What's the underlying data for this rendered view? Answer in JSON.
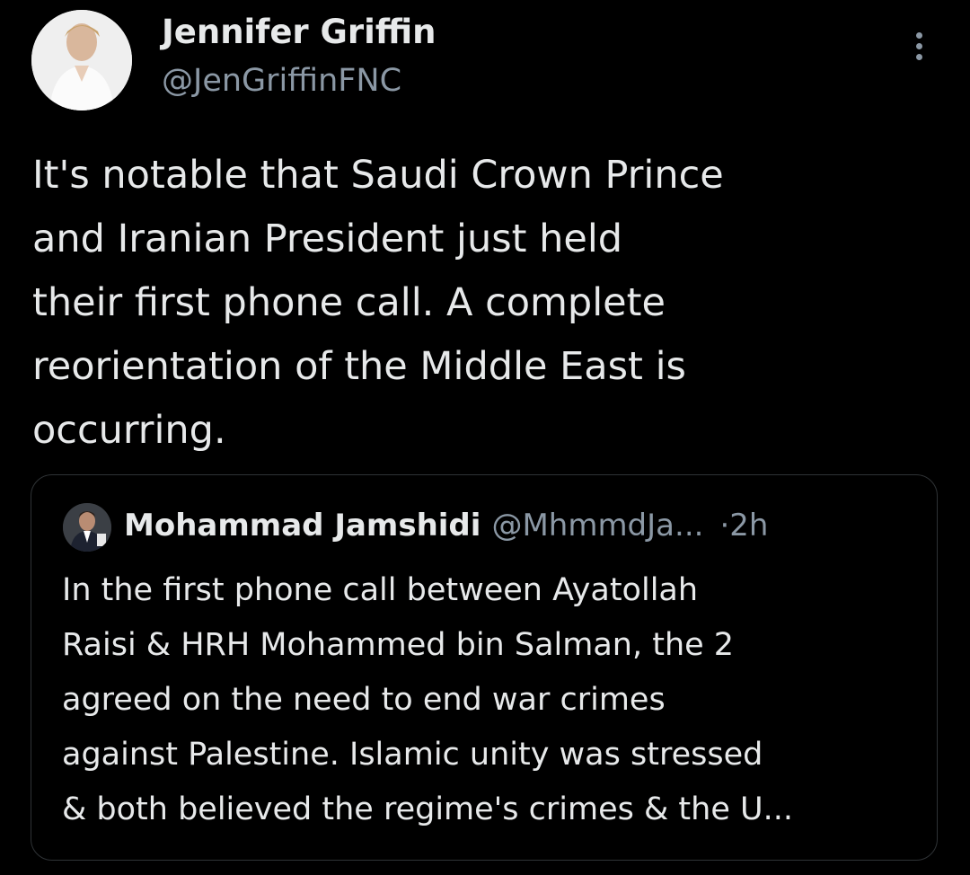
{
  "tweet": {
    "author_name": "Jennifer Griffin",
    "author_handle": "@JenGriffinFNC",
    "avatar_icon": "profile-photo",
    "more_icon": "more-vertical-icon",
    "text_lines": [
      "It's notable that Saudi Crown Prince",
      "and Iranian President just held",
      "their first phone call. A complete",
      "reorientation of the Middle East is",
      "occurring."
    ]
  },
  "quote": {
    "author_name": "Mohammad Jamshidi",
    "author_handle": "@MhmmdJa...",
    "separator": "·",
    "time": "2h",
    "text_lines": [
      "In the first phone call between Ayatollah",
      "Raisi & HRH Mohammed bin Salman, the 2",
      "agreed on the need to end war crimes",
      "against Palestine. Islamic unity was stressed",
      "& both believed the regime's crimes & the U..."
    ]
  },
  "colors": {
    "background": "#000000",
    "primary_text": "#e7e9ea",
    "secondary_text": "#8b98a5",
    "border": "#2f3336"
  }
}
